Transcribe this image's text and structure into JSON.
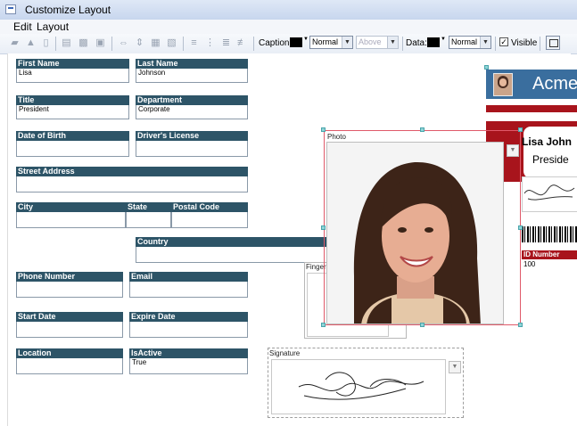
{
  "window": {
    "title": "Customize Layout"
  },
  "menu": {
    "items": [
      "Edit",
      "Layout"
    ]
  },
  "toolbar": {
    "caption_label": "Caption:",
    "caption_font": "Normal",
    "caption_position": "Above",
    "data_label": "Data:",
    "data_font": "Normal",
    "visible_label": "Visible",
    "visible_checked": true
  },
  "fields": {
    "first_name": {
      "label": "First Name",
      "value": "Lisa"
    },
    "last_name": {
      "label": "Last Name",
      "value": "Johnson"
    },
    "title": {
      "label": "Title",
      "value": "President"
    },
    "department": {
      "label": "Department",
      "value": "Corporate"
    },
    "dob": {
      "label": "Date of Birth",
      "value": ""
    },
    "license": {
      "label": "Driver's License",
      "value": ""
    },
    "street": {
      "label": "Street Address",
      "value": ""
    },
    "city": {
      "label": "City",
      "value": ""
    },
    "state": {
      "label": "State",
      "value": ""
    },
    "postal": {
      "label": "Postal Code",
      "value": ""
    },
    "country": {
      "label": "Country",
      "value": ""
    },
    "phone": {
      "label": "Phone Number",
      "value": ""
    },
    "email": {
      "label": "Email",
      "value": ""
    },
    "start_date": {
      "label": "Start Date",
      "value": ""
    },
    "expire_date": {
      "label": "Expire Date",
      "value": ""
    },
    "location": {
      "label": "Location",
      "value": ""
    },
    "is_active": {
      "label": "IsActive",
      "value": "True"
    }
  },
  "photo": {
    "caption": "Photo"
  },
  "fingerprint": {
    "caption": "Finger"
  },
  "signature": {
    "caption": "Signature"
  },
  "card_preview": {
    "company": "Acme",
    "name": "Lisa John",
    "title": "Preside",
    "id_label": "ID Number",
    "id_value": "100"
  },
  "colors": {
    "label_bg": "#2d5467",
    "selection_border": "#e05a6a",
    "card_red": "#a8141c",
    "card_blue": "#3a6e9e"
  }
}
